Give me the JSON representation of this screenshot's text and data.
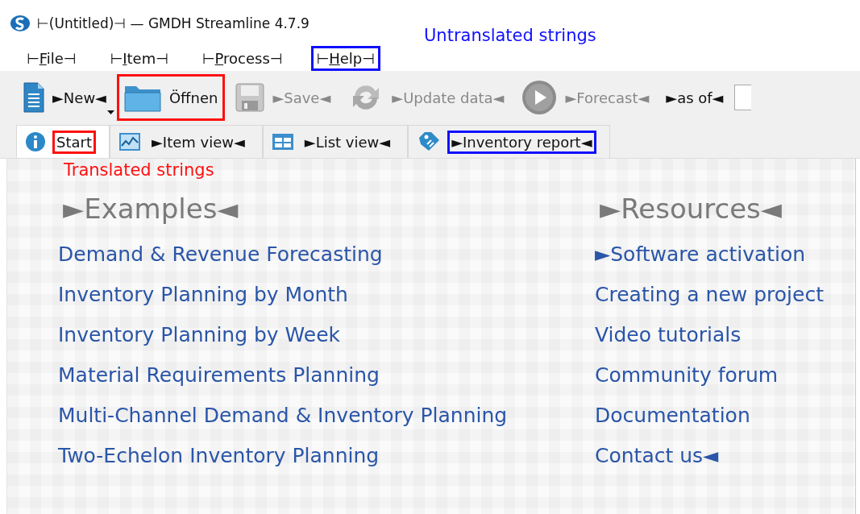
{
  "window": {
    "title": "⊢(Untitled)⊣ — GMDH Streamline 4.7.9"
  },
  "annotations": [
    {
      "text": "Untranslated strings",
      "color": "#1010ff"
    },
    {
      "text": "Translated strings",
      "color": "#ff1010"
    }
  ],
  "menu": [
    {
      "before": "⊢",
      "key": "F",
      "after": "ile⊣"
    },
    {
      "before": "⊢",
      "key": "I",
      "after": "tem⊣"
    },
    {
      "before": "⊢",
      "key": "P",
      "after": "rocess⊣"
    },
    {
      "before": "⊢",
      "key": "H",
      "after": "elp⊣",
      "color": "#1010ff"
    }
  ],
  "toolbar": [
    {
      "kind": "button",
      "label": "►New◄",
      "disabled": false,
      "dropdown": true
    },
    {
      "kind": "button",
      "label": "Öffnen",
      "disabled": false,
      "dropdown": false,
      "color": "#ff1010"
    },
    {
      "kind": "button",
      "label": "►Save◄",
      "disabled": true,
      "dropdown": false
    },
    {
      "kind": "button",
      "label": "►Update data◄",
      "disabled": true,
      "dropdown": false
    },
    {
      "kind": "button",
      "label": "►Forecast◄",
      "disabled": true,
      "dropdown": false
    },
    {
      "kind": "label",
      "label": "►as of◄"
    },
    {
      "kind": "field"
    }
  ],
  "tabs": [
    {
      "label": "Start",
      "selected": true,
      "color": "#ff1010"
    },
    {
      "label": "►Item view◄",
      "selected": false
    },
    {
      "label": "►List view◄",
      "selected": false
    },
    {
      "label": "►Inventory report◄",
      "selected": false,
      "color": "#1010ff"
    }
  ],
  "sections": [
    {
      "heading": "►Examples◄",
      "links": [
        "Demand & Revenue Forecasting",
        "Inventory Planning by Month",
        "Inventory Planning by Week",
        "Material Requirements Planning",
        "Multi-Channel Demand & Inventory Planning",
        "Two-Echelon Inventory Planning"
      ]
    },
    {
      "heading": "►Resources◄",
      "links": [
        "►Software activation",
        "Creating a new project",
        "Video tutorials",
        "Community forum",
        "Documentation",
        "Contact us◄"
      ]
    }
  ]
}
